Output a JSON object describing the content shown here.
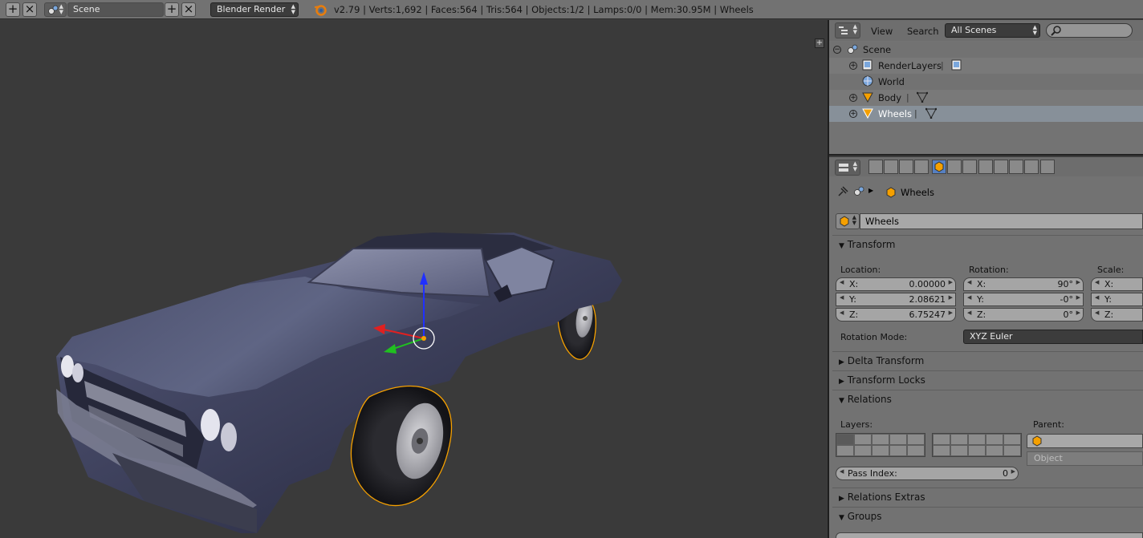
{
  "topbar": {
    "scene_name": "Scene",
    "render_engine": "Blender Render",
    "stats": "v2.79 | Verts:1,692 | Faces:564 | Tris:564 | Objects:1/2 | Lamps:0/0 | Mem:30.95M | Wheels"
  },
  "outliner": {
    "menu_view": "View",
    "menu_search": "Search",
    "display_mode": "All Scenes",
    "rows": [
      {
        "label": "Scene"
      },
      {
        "label": "RenderLayers"
      },
      {
        "label": "World"
      },
      {
        "label": "Body"
      },
      {
        "label": "Wheels"
      }
    ]
  },
  "properties": {
    "breadcrumb_object": "Wheels",
    "object_name": "Wheels",
    "transform": {
      "title": "Transform",
      "location_label": "Location:",
      "rotation_label": "Rotation:",
      "scale_label": "Scale:",
      "location": [
        {
          "axis": "X:",
          "value": "0.00000"
        },
        {
          "axis": "Y:",
          "value": "2.08621"
        },
        {
          "axis": "Z:",
          "value": "6.75247"
        }
      ],
      "rotation": [
        {
          "axis": "X:",
          "value": "90°"
        },
        {
          "axis": "Y:",
          "value": "-0°"
        },
        {
          "axis": "Z:",
          "value": "0°"
        }
      ],
      "scale": [
        {
          "axis": "X:"
        },
        {
          "axis": "Y:"
        },
        {
          "axis": "Z:"
        }
      ],
      "rotation_mode_label": "Rotation Mode:",
      "rotation_mode": "XYZ Euler"
    },
    "panels": {
      "delta": "Delta Transform",
      "locks": "Transform Locks",
      "relations": "Relations",
      "relations_extras": "Relations Extras",
      "groups": "Groups"
    },
    "relations": {
      "layers_label": "Layers:",
      "parent_label": "Parent:",
      "parent_type": "Object",
      "pass_index_label": "Pass Index:",
      "pass_index": "0"
    }
  },
  "colors": {
    "selection_orange": "#f5a000",
    "gizmo_x": "#e02020",
    "gizmo_y": "#20c020",
    "gizmo_z": "#2030ff",
    "active_tab": "#5680c2"
  }
}
